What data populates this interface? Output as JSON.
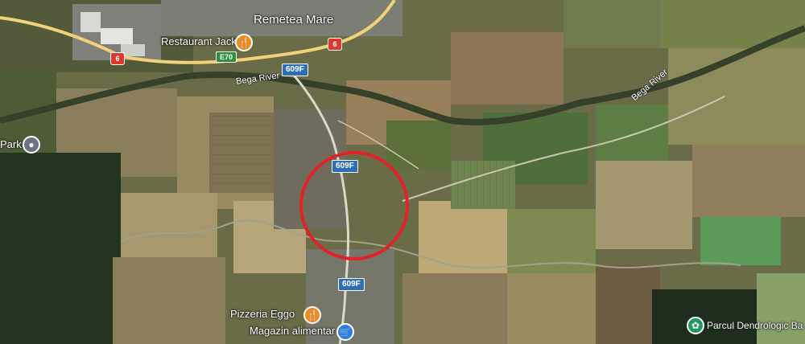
{
  "map": {
    "town_label": "Remetea Mare",
    "river_labels": [
      "Bega River",
      "Bega River"
    ],
    "roads": {
      "route_6_a": "6",
      "route_6_b": "6",
      "euro_route": "E70",
      "county_609f_a": "609F",
      "county_609f_b": "609F",
      "county_609f_c": "609F"
    },
    "pois": {
      "restaurant": "Restaurant Jack",
      "pizzeria": "Pizzeria Eggo",
      "grocery": "Magazin alimentar",
      "park_left": "Park",
      "dendro_park": "Parcul Dendrologic Ba"
    },
    "icons": {
      "food": "fork-knife-icon",
      "shop": "shopping-cart-icon",
      "park": "tree-icon",
      "place": "place-pin-icon"
    },
    "colors": {
      "highlight_circle": "#e0222b",
      "road_main": "#f1d27a",
      "road_minor": "#d9d9c8",
      "river": "#36412a"
    }
  }
}
